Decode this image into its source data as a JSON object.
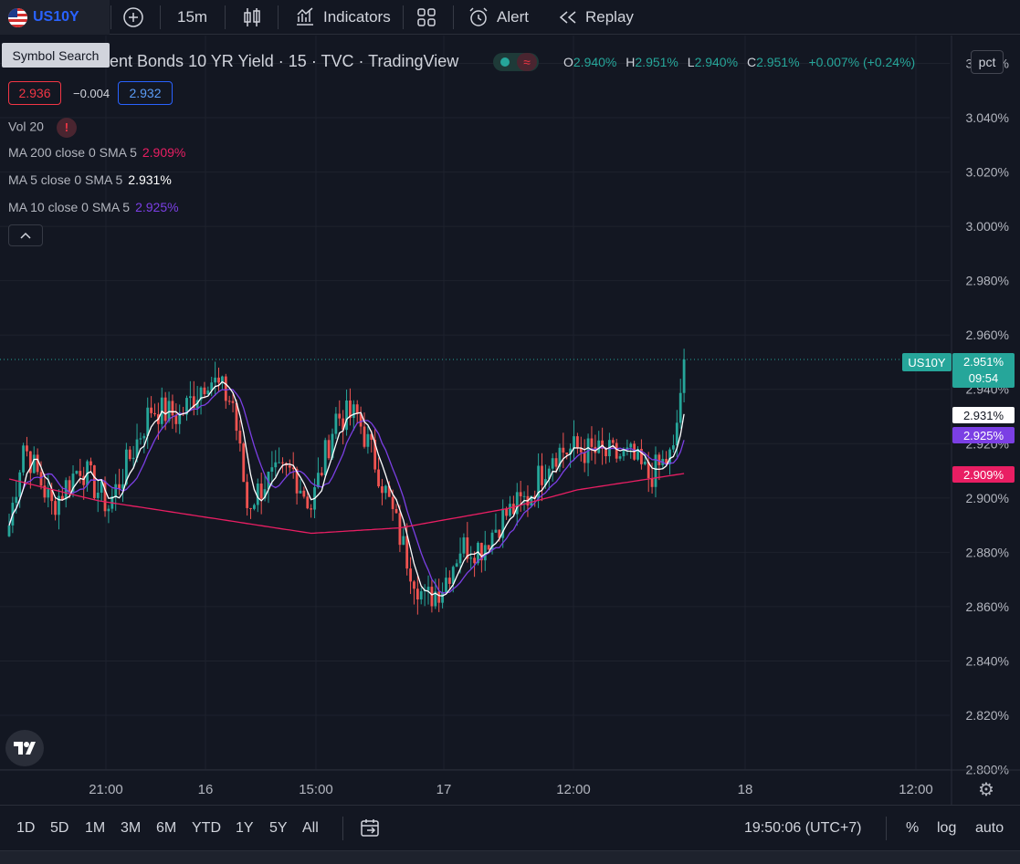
{
  "toolbar": {
    "symbol": "US10Y",
    "interval": "15m",
    "indicators_label": "Indicators",
    "alert_label": "Alert",
    "replay_label": "Replay"
  },
  "tooltip": "Symbol Search",
  "legend": {
    "title": "ent Bonds 10 YR Yield · 15 · TVC · TradingView",
    "open_label": "O",
    "open": "2.940%",
    "high_label": "H",
    "high": "2.951%",
    "low_label": "L",
    "low": "2.940%",
    "close_label": "C",
    "close": "2.951%",
    "change": "+0.007% (+0.24%)",
    "bid": "2.936",
    "spread": "−0.004",
    "ask": "2.932",
    "status_wave_symbol": "≈",
    "vol_label": "Vol 20",
    "vol_warning": "!",
    "ma200_label": "MA 200 close 0 SMA 5",
    "ma200_value": "2.909%",
    "ma5_label": "MA 5 close 0 SMA 5",
    "ma5_value": "2.931%",
    "ma10_label": "MA 10 close 0 SMA 5",
    "ma10_value": "2.925%"
  },
  "pct_button": "pct",
  "price_axis": {
    "labels": [
      "3.060%",
      "3.040%",
      "3.020%",
      "3.000%",
      "2.980%",
      "2.960%",
      "2.940%",
      "2.920%",
      "2.900%",
      "2.880%",
      "2.860%",
      "2.840%",
      "2.820%",
      "2.800%"
    ],
    "values": [
      3.06,
      3.04,
      3.02,
      3.0,
      2.98,
      2.96,
      2.94,
      2.92,
      2.9,
      2.88,
      2.86,
      2.84,
      2.82,
      2.8
    ],
    "last_symbol": "US10Y",
    "last_price": "2.951%",
    "countdown": "09:54",
    "ma5_tag": "2.931%",
    "ma10_tag": "2.925%",
    "ma200_tag": "2.909%"
  },
  "time_axis": {
    "labels": [
      "21:00",
      "16",
      "15:00",
      "17",
      "12:00",
      "18",
      "12:00"
    ]
  },
  "logo_text": "17",
  "gear_icon": "⚙",
  "bottom_bar": {
    "ranges": [
      "1D",
      "5D",
      "1M",
      "3M",
      "6M",
      "YTD",
      "1Y",
      "5Y",
      "All"
    ],
    "clock": "19:50:06 (UTC+7)",
    "percent_label": "%",
    "log_label": "log",
    "auto_label": "auto"
  },
  "colors": {
    "up": "#26a69a",
    "down": "#ef5350",
    "ma5": "#ffffff",
    "ma10": "#7b3fe4",
    "ma200": "#e91e63",
    "accent": "#2962ff"
  },
  "chart_data": {
    "type": "candlestick",
    "symbol": "US10Y",
    "interval": "15",
    "ylim": [
      2.8,
      3.06
    ],
    "anchors": [
      {
        "bar": 0,
        "price": 2.89
      },
      {
        "bar": 4,
        "price": 2.92
      },
      {
        "bar": 12,
        "price": 2.897
      },
      {
        "bar": 20,
        "price": 2.912
      },
      {
        "bar": 28,
        "price": 2.897
      },
      {
        "bar": 40,
        "price": 2.933
      },
      {
        "bar": 48,
        "price": 2.93
      },
      {
        "bar": 56,
        "price": 2.945
      },
      {
        "bar": 63,
        "price": 2.935
      },
      {
        "bar": 67,
        "price": 2.897
      },
      {
        "bar": 72,
        "price": 2.906
      },
      {
        "bar": 80,
        "price": 2.91
      },
      {
        "bar": 85,
        "price": 2.897
      },
      {
        "bar": 92,
        "price": 2.93
      },
      {
        "bar": 98,
        "price": 2.93
      },
      {
        "bar": 104,
        "price": 2.91
      },
      {
        "bar": 112,
        "price": 2.878
      },
      {
        "bar": 117,
        "price": 2.862
      },
      {
        "bar": 122,
        "price": 2.868
      },
      {
        "bar": 127,
        "price": 2.882
      },
      {
        "bar": 133,
        "price": 2.882
      },
      {
        "bar": 139,
        "price": 2.893
      },
      {
        "bar": 146,
        "price": 2.9
      },
      {
        "bar": 153,
        "price": 2.917
      },
      {
        "bar": 160,
        "price": 2.918
      },
      {
        "bar": 167,
        "price": 2.916
      },
      {
        "bar": 175,
        "price": 2.915
      },
      {
        "bar": 180,
        "price": 2.908
      },
      {
        "bar": 187,
        "price": 2.916
      },
      {
        "bar": 190,
        "price": 2.951
      }
    ],
    "ma200_points": [
      {
        "bar": 0,
        "price": 2.907
      },
      {
        "bar": 25,
        "price": 2.899
      },
      {
        "bar": 55,
        "price": 2.893
      },
      {
        "bar": 85,
        "price": 2.887
      },
      {
        "bar": 110,
        "price": 2.889
      },
      {
        "bar": 140,
        "price": 2.896
      },
      {
        "bar": 160,
        "price": 2.903
      },
      {
        "bar": 190,
        "price": 2.909
      }
    ]
  }
}
